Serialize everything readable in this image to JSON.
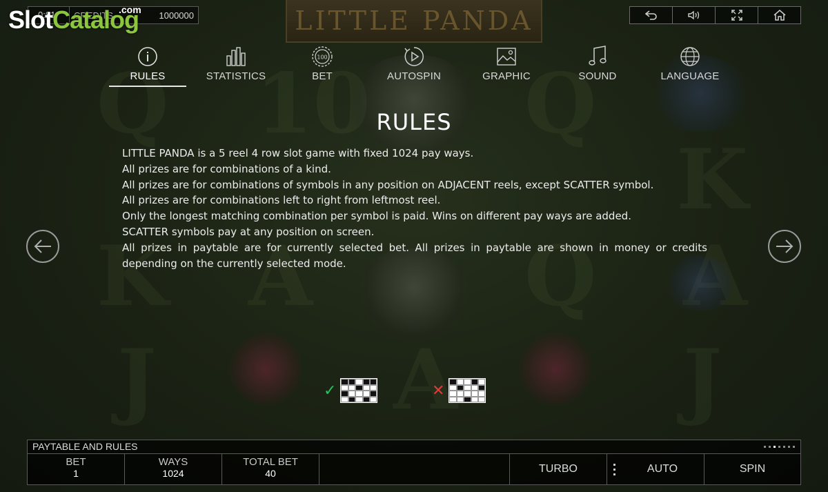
{
  "logo": {
    "slot": "Slot",
    "catalog": "Catalog",
    "com": ".com"
  },
  "top_info": {
    "time": "0:01",
    "credits_label": "CREDITS",
    "credits_value": "1000000"
  },
  "game_title": "LITTLE PANDA",
  "top_buttons": [
    {
      "icon": "back-arrow-icon",
      "glyph": "⤺"
    },
    {
      "icon": "sound-icon",
      "glyph": "🔉"
    },
    {
      "icon": "fullscreen-icon",
      "glyph": "⤢"
    },
    {
      "icon": "home-icon",
      "glyph": "⌂"
    }
  ],
  "tabs": [
    {
      "label": "RULES",
      "icon": "info-icon",
      "active": true
    },
    {
      "label": "STATISTICS",
      "icon": "bar-chart-icon",
      "active": false
    },
    {
      "label": "BET",
      "icon": "chip-icon",
      "chip_text": "100",
      "active": false
    },
    {
      "label": "AUTOSPIN",
      "icon": "autospin-icon",
      "active": false
    },
    {
      "label": "GRAPHIC",
      "icon": "image-icon",
      "active": false
    },
    {
      "label": "SOUND",
      "icon": "music-icon",
      "active": false
    },
    {
      "label": "LANGUAGE",
      "icon": "globe-icon",
      "active": false
    }
  ],
  "rules": {
    "title": "RULES",
    "lines": [
      "LITTLE PANDA is a 5 reel 4 row slot game with fixed 1024 pay ways.",
      "All prizes are for combinations of a kind.",
      "All prizes are for combinations of symbols in any position on ADJACENT reels, except SCATTER symbol.",
      "All prizes are for combinations left to right from leftmost reel.",
      "Only the longest matching combination per symbol is paid. Wins on different pay ways are added.",
      "SCATTER symbols pay at any position on screen.",
      "All prizes in paytable are for currently selected bet. All prizes in paytable are shown in money or credits depending on the currently selected mode."
    ]
  },
  "examples": {
    "valid_mark": "✓",
    "invalid_mark": "✕",
    "valid_color": "#22c55e",
    "invalid_color": "#e03b3b"
  },
  "bottom": {
    "header": "PAYTABLE AND RULES",
    "bet_label": "BET",
    "bet_value": "1",
    "ways_label": "WAYS",
    "ways_value": "1024",
    "total_bet_label": "TOTAL BET",
    "total_bet_value": "40",
    "turbo_label": "TURBO",
    "auto_label": "AUTO",
    "spin_label": "SPIN"
  }
}
